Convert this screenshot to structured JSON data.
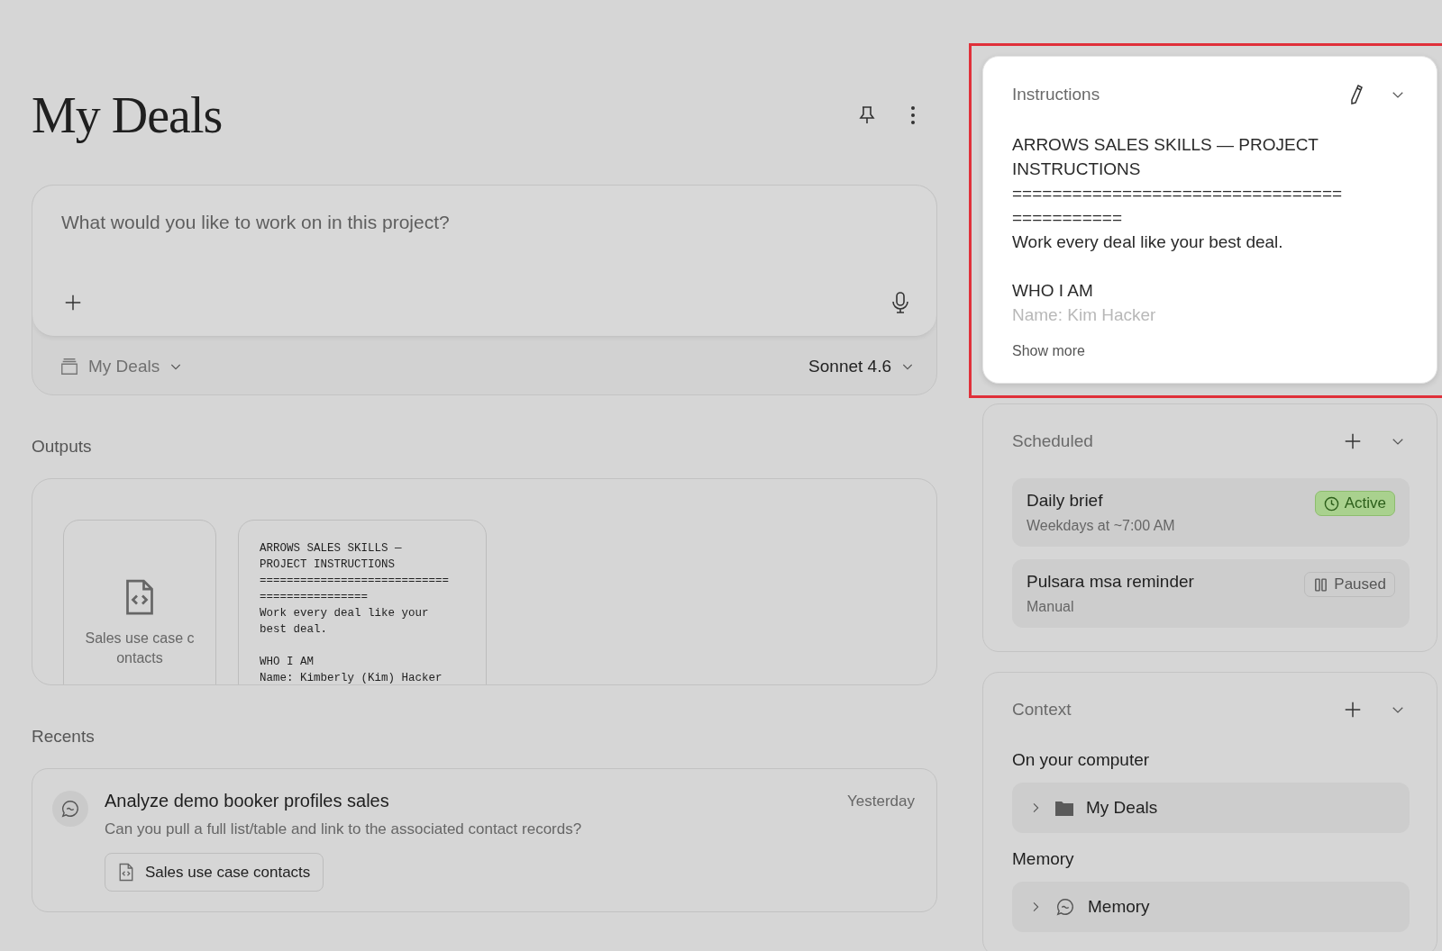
{
  "project": {
    "title": "My Deals"
  },
  "composer": {
    "placeholder": "What would you like to work on in this project?",
    "project_label": "My Deals",
    "model": "Sonnet 4.6"
  },
  "outputs": {
    "heading": "Outputs",
    "items": [
      {
        "kind": "file",
        "label": "Sales use case contacts"
      },
      {
        "kind": "document",
        "paragraphs": [
          [
            "ARROWS SALES SKILLS —",
            "PROJECT INSTRUCTIONS",
            "============================",
            "================",
            "Work every deal like your",
            "best deal."
          ],
          [
            "WHO I AM",
            "Name: Kimberly (Kim) Hacker"
          ]
        ]
      }
    ]
  },
  "recents": {
    "heading": "Recents",
    "items": [
      {
        "title": "Analyze demo booker profiles sales",
        "time": "Yesterday",
        "preview": "Can you pull a full list/table and link to the associated contact records?",
        "attachment": "Sales use case contacts"
      }
    ]
  },
  "instructions": {
    "heading": "Instructions",
    "highlighted": true,
    "expanded": true,
    "paragraphs": [
      [
        "ARROWS SALES SKILLS — PROJECT INSTRUCTIONS",
        "=================================",
        "===========",
        "Work every deal like your best deal."
      ],
      [
        "WHO I AM",
        "Name: Kim Hacker"
      ]
    ],
    "show_more": "Show more"
  },
  "scheduled": {
    "heading": "Scheduled",
    "expanded": true,
    "items": [
      {
        "name": "Daily brief",
        "schedule": "Weekdays at ~7:00 AM",
        "active": true,
        "status_label": "Active"
      },
      {
        "name": "Pulsara msa reminder",
        "schedule": "Manual",
        "active": false,
        "status_label": "Paused"
      }
    ]
  },
  "context": {
    "heading": "Context",
    "expanded": true,
    "groups": [
      {
        "heading": "On your computer",
        "items": [
          {
            "kind": "folder",
            "label": "My Deals",
            "expanded": false
          }
        ]
      },
      {
        "heading": "Memory",
        "items": [
          {
            "kind": "memory",
            "label": "Memory",
            "expanded": false
          }
        ]
      }
    ]
  }
}
